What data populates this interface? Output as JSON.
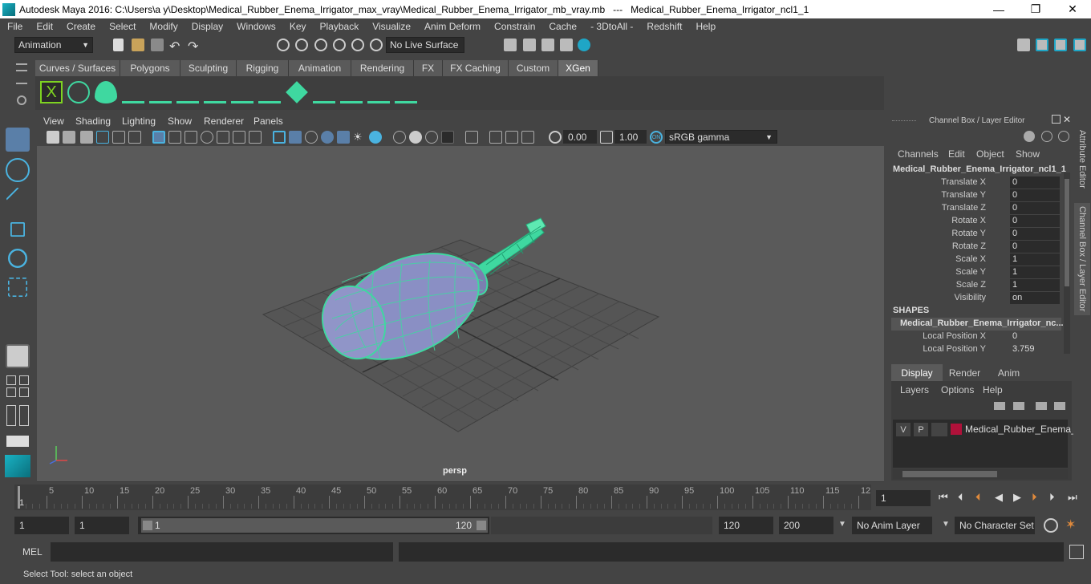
{
  "window": {
    "title": "Autodesk Maya 2016: C:\\Users\\a y\\Desktop\\Medical_Rubber_Enema_Irrigator_max_vray\\Medical_Rubber_Enema_Irrigator_mb_vray.mb   ---   Medical_Rubber_Enema_Irrigator_ncl1_1",
    "minimize": "—",
    "maximize": "❐",
    "close": "✕"
  },
  "menubar": [
    "File",
    "Edit",
    "Create",
    "Select",
    "Modify",
    "Display",
    "Windows",
    "Key",
    "Playback",
    "Visualize",
    "Anim Deform",
    "Constrain",
    "Cache",
    "- 3DtoAll -",
    "Redshift",
    "Help"
  ],
  "statusline": {
    "menuset": "Animation",
    "live_surface": "No Live Surface"
  },
  "shelf_tabs": [
    "Curves / Surfaces",
    "Polygons",
    "Sculpting",
    "Rigging",
    "Animation",
    "Rendering",
    "FX",
    "FX Caching",
    "Custom",
    "XGen"
  ],
  "shelf_active": "XGen",
  "viewport": {
    "menus": [
      "View",
      "Shading",
      "Lighting",
      "Show",
      "Renderer",
      "Panels"
    ],
    "exposure": "0.00",
    "gamma": "1.00",
    "colorspace": "sRGB gamma",
    "camera_label": "persp"
  },
  "channel_box": {
    "header": "Channel Box / Layer Editor",
    "menus": [
      "Channels",
      "Edit",
      "Object",
      "Show"
    ],
    "object_name": "Medical_Rubber_Enema_Irrigator_ncl1_1",
    "channels": [
      {
        "name": "Translate X",
        "value": "0"
      },
      {
        "name": "Translate Y",
        "value": "0"
      },
      {
        "name": "Translate Z",
        "value": "0"
      },
      {
        "name": "Rotate X",
        "value": "0"
      },
      {
        "name": "Rotate Y",
        "value": "0"
      },
      {
        "name": "Rotate Z",
        "value": "0"
      },
      {
        "name": "Scale X",
        "value": "1"
      },
      {
        "name": "Scale Y",
        "value": "1"
      },
      {
        "name": "Scale Z",
        "value": "1"
      },
      {
        "name": "Visibility",
        "value": "on"
      }
    ],
    "shapes_header": "SHAPES",
    "shape_name": "Medical_Rubber_Enema_Irrigator_nc...",
    "shape_channels": [
      {
        "name": "Local Position X",
        "value": "0"
      },
      {
        "name": "Local Position Y",
        "value": "3.759"
      }
    ]
  },
  "layer_editor": {
    "tabs": [
      "Display",
      "Render",
      "Anim"
    ],
    "active_tab": "Display",
    "menus": [
      "Layers",
      "Options",
      "Help"
    ],
    "layer": {
      "v": "V",
      "p": "P",
      "name": "Medical_Rubber_Enema_",
      "color": "#b0113a"
    }
  },
  "side_tabs": [
    "Attribute Editor",
    "Channel Box / Layer Editor"
  ],
  "timeline": {
    "ticks": [
      "5",
      "10",
      "15",
      "20",
      "25",
      "30",
      "35",
      "40",
      "45",
      "50",
      "55",
      "60",
      "65",
      "70",
      "75",
      "80",
      "85",
      "90",
      "95",
      "100",
      "105",
      "110",
      "115",
      "12"
    ],
    "start_label": "1",
    "current_frame": "1"
  },
  "range": {
    "start": "1",
    "anim_start": "1",
    "slider_start": "1",
    "slider_end": "120",
    "end": "120",
    "anim_end": "200",
    "anim_layer": "No Anim Layer",
    "character_set": "No Character Set"
  },
  "cmdline": {
    "label": "MEL"
  },
  "helpline": {
    "text": "Select Tool: select an object"
  },
  "colors": {
    "accent_teal": "#3fd8a0",
    "xgen_active": "#686868",
    "layer_color": "#b0113a"
  }
}
